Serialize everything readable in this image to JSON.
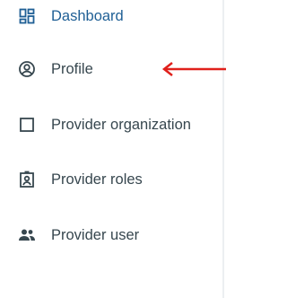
{
  "sidebar": {
    "items": [
      {
        "label": "Dashboard",
        "icon": "dashboard-icon",
        "active": true
      },
      {
        "label": "Profile",
        "icon": "account-circle-icon",
        "active": false
      },
      {
        "label": "Provider organization",
        "icon": "square-outline-icon",
        "active": false
      },
      {
        "label": "Provider roles",
        "icon": "badge-icon",
        "active": false
      },
      {
        "label": "Provider user",
        "icon": "people-icon",
        "active": false
      }
    ]
  },
  "annotation": {
    "arrow_color": "#e0201b",
    "points_to": "Profile"
  },
  "colors": {
    "active": "#1f5f95",
    "text": "#37474f",
    "icon": "#37474f"
  }
}
